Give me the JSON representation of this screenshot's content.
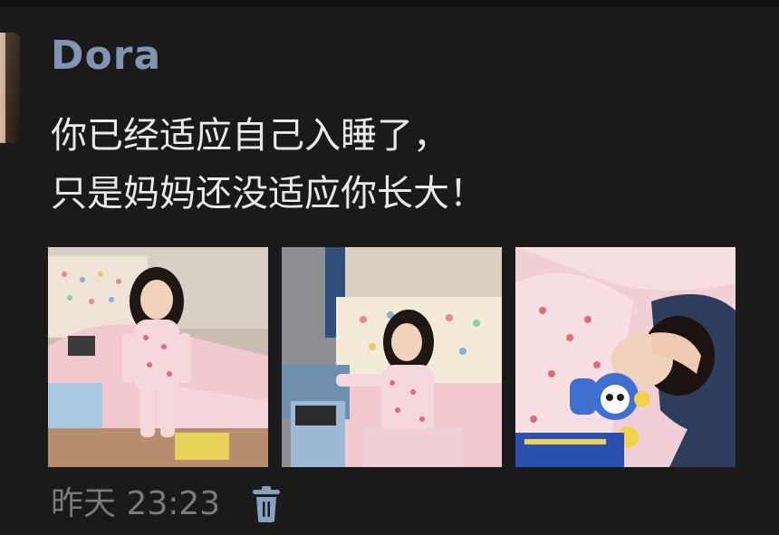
{
  "post": {
    "author": "Dora",
    "text": "你已经适应自己入睡了，\n只是妈妈还没适应你长大！",
    "photos": [
      {
        "icon": "photo-girl-standing-on-bed"
      },
      {
        "icon": "photo-girl-sitting-at-table"
      },
      {
        "icon": "photo-girl-sleeping"
      }
    ],
    "timestamp": "昨天 23:23",
    "delete_icon": "trash-icon"
  },
  "colors": {
    "background": "#1a1a1a",
    "author": "#8294b2",
    "text": "#eaeaea",
    "meta": "#7b7b7b"
  }
}
